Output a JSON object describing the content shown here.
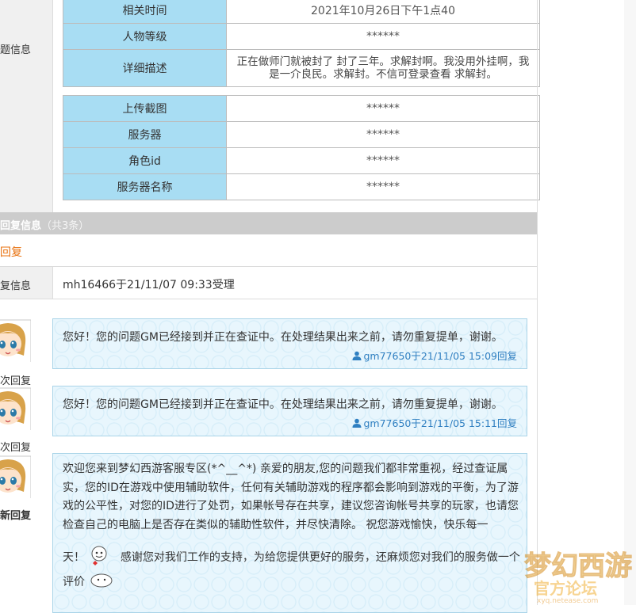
{
  "sidebar": {
    "problem_info_label": "题信息"
  },
  "info_table": {
    "rows": [
      {
        "label": "相关时间",
        "value": "2021年10月26日下午1点40"
      },
      {
        "label": "人物等级",
        "value": "******"
      },
      {
        "label": "详细描述",
        "value": "正在做师门就被封了 封了三年。求解封啊。我没用外挂啊，我是一介良民。求解封。不信可登录查看 求解封。"
      },
      {
        "label": "上传截图",
        "value": "******"
      },
      {
        "label": "服务器",
        "value": "******"
      },
      {
        "label": "角色id",
        "value": "******"
      },
      {
        "label": "服务器名称",
        "value": "******"
      }
    ]
  },
  "reply_section": {
    "title": "回复信息",
    "count": "（共3条）",
    "reply_link": "回复",
    "accept_label": "复信息",
    "accept_value": "mh16466于21/11/07 09:33受理"
  },
  "messages": [
    {
      "side_label": "次回复",
      "text": "您好！您的问题GM已经接到并正在查证中。在处理结果出来之前，请勿重复提单，谢谢。",
      "meta": "gm77650于21/11/05 15:09回复"
    },
    {
      "side_label": "次回复",
      "text": "您好！您的问题GM已经接到并正在查证中。在处理结果出来之前，请勿重复提单，谢谢。",
      "meta": "gm77650于21/11/05 15:11回复"
    },
    {
      "side_label": "新回复",
      "text": "欢迎您来到梦幻西游客服专区(*^__^*) 亲爱的朋友,您的问题我们都非常重视，经过查证属实，您的ID在游戏中使用辅助软件，任何有关辅助游戏的程序都会影响到游戏的平衡，为了游戏的公平性，对您的ID进行了处罚，如果帐号存在共享，建议您咨询帐号共享的玩家，也请您检查自己的电脑上是否存在类似的辅助性软件，并尽快清除。  祝您游戏愉快，快乐每一",
      "text_line2_start": "天！",
      "text_line2_end": "感谢您对我们工作的支持，为给您提供更好的服务，还麻烦您对我们的服务做一个",
      "text_line3": "评价"
    }
  ],
  "colors": {
    "label_bg": "#a8ddf3",
    "reply_link": "#e8700d",
    "meta_link": "#2f7fc1",
    "header_bg": "#cccccc"
  }
}
